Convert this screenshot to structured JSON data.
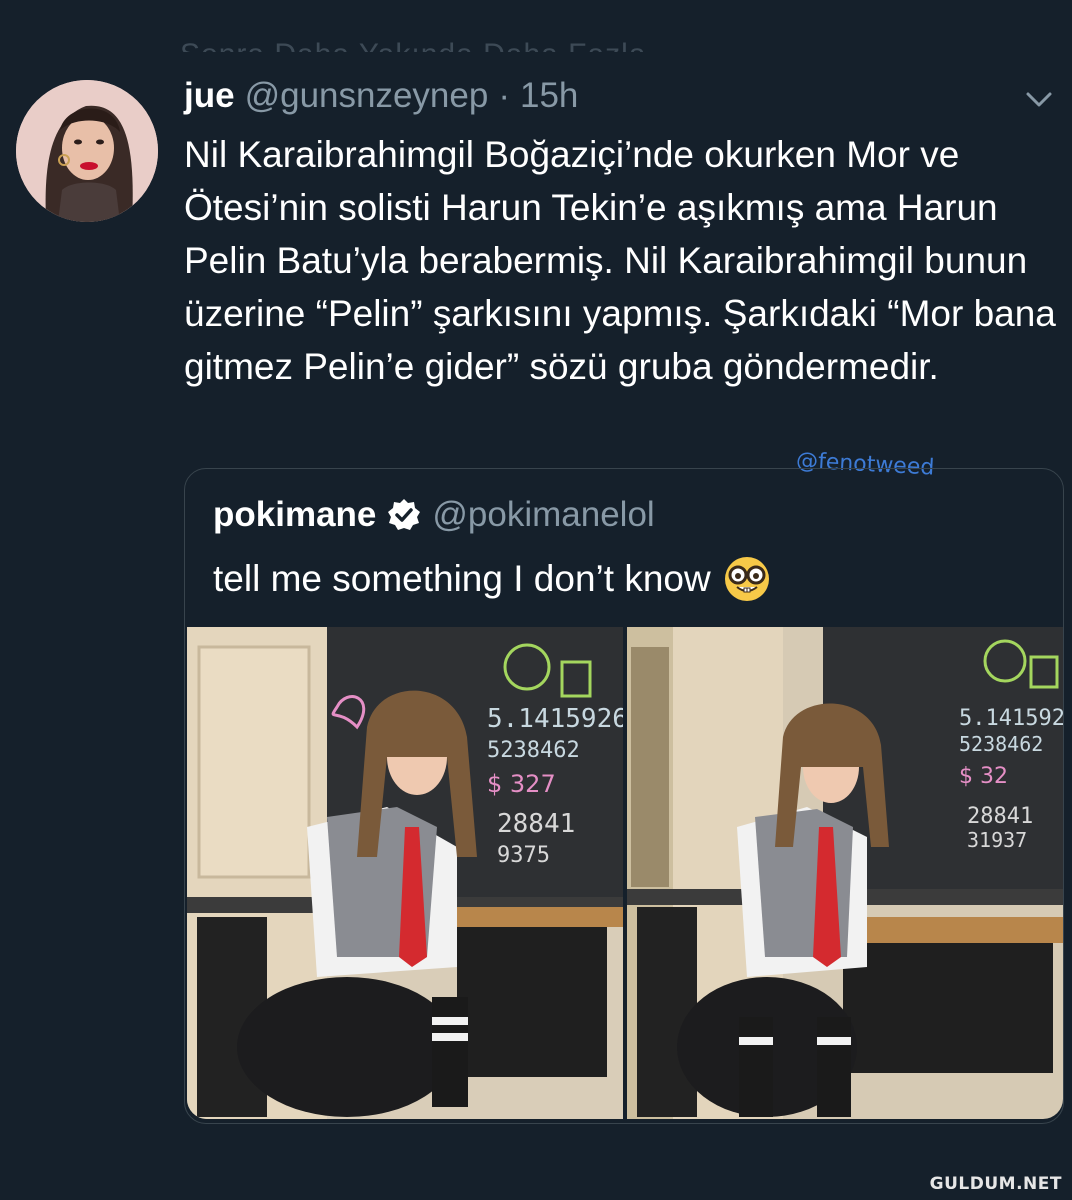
{
  "cutoff_text": "Sonra Daha Yakında Daha Fazla",
  "tweet": {
    "name": "jue",
    "handle": "@gunsnzeynep",
    "separator": "·",
    "time": "15h",
    "text": "Nil Karaibrahimgil Boğaziçi’nde okurken Mor ve Ötesi’nin solisti Harun Tekin’e aşıkmış ama Harun Pelin Batu’yla berabermiş. Nil Karaibrahimgil bunun üzerine “Pelin” şarkısını yapmış. Şarkıdaki “Mor bana gitmez Pelin’e gider” sözü gruba göndermedir.",
    "menu_icon": "chevron-down-icon"
  },
  "watermark": "@fenotweed",
  "quote": {
    "name": "pokimane",
    "verified_icon": "verified-badge-icon",
    "handle": "@pokimanelol",
    "text": "tell me something I don’t know",
    "emoji": "nerd-face-emoji",
    "photos": [
      "classroom-photo-1",
      "classroom-photo-2"
    ]
  },
  "brand": "GULDUM.NET",
  "colors": {
    "background": "#15202b",
    "text": "#ffffff",
    "secondary": "#8899a6",
    "border": "#38444d",
    "verified": "#ffffff"
  }
}
